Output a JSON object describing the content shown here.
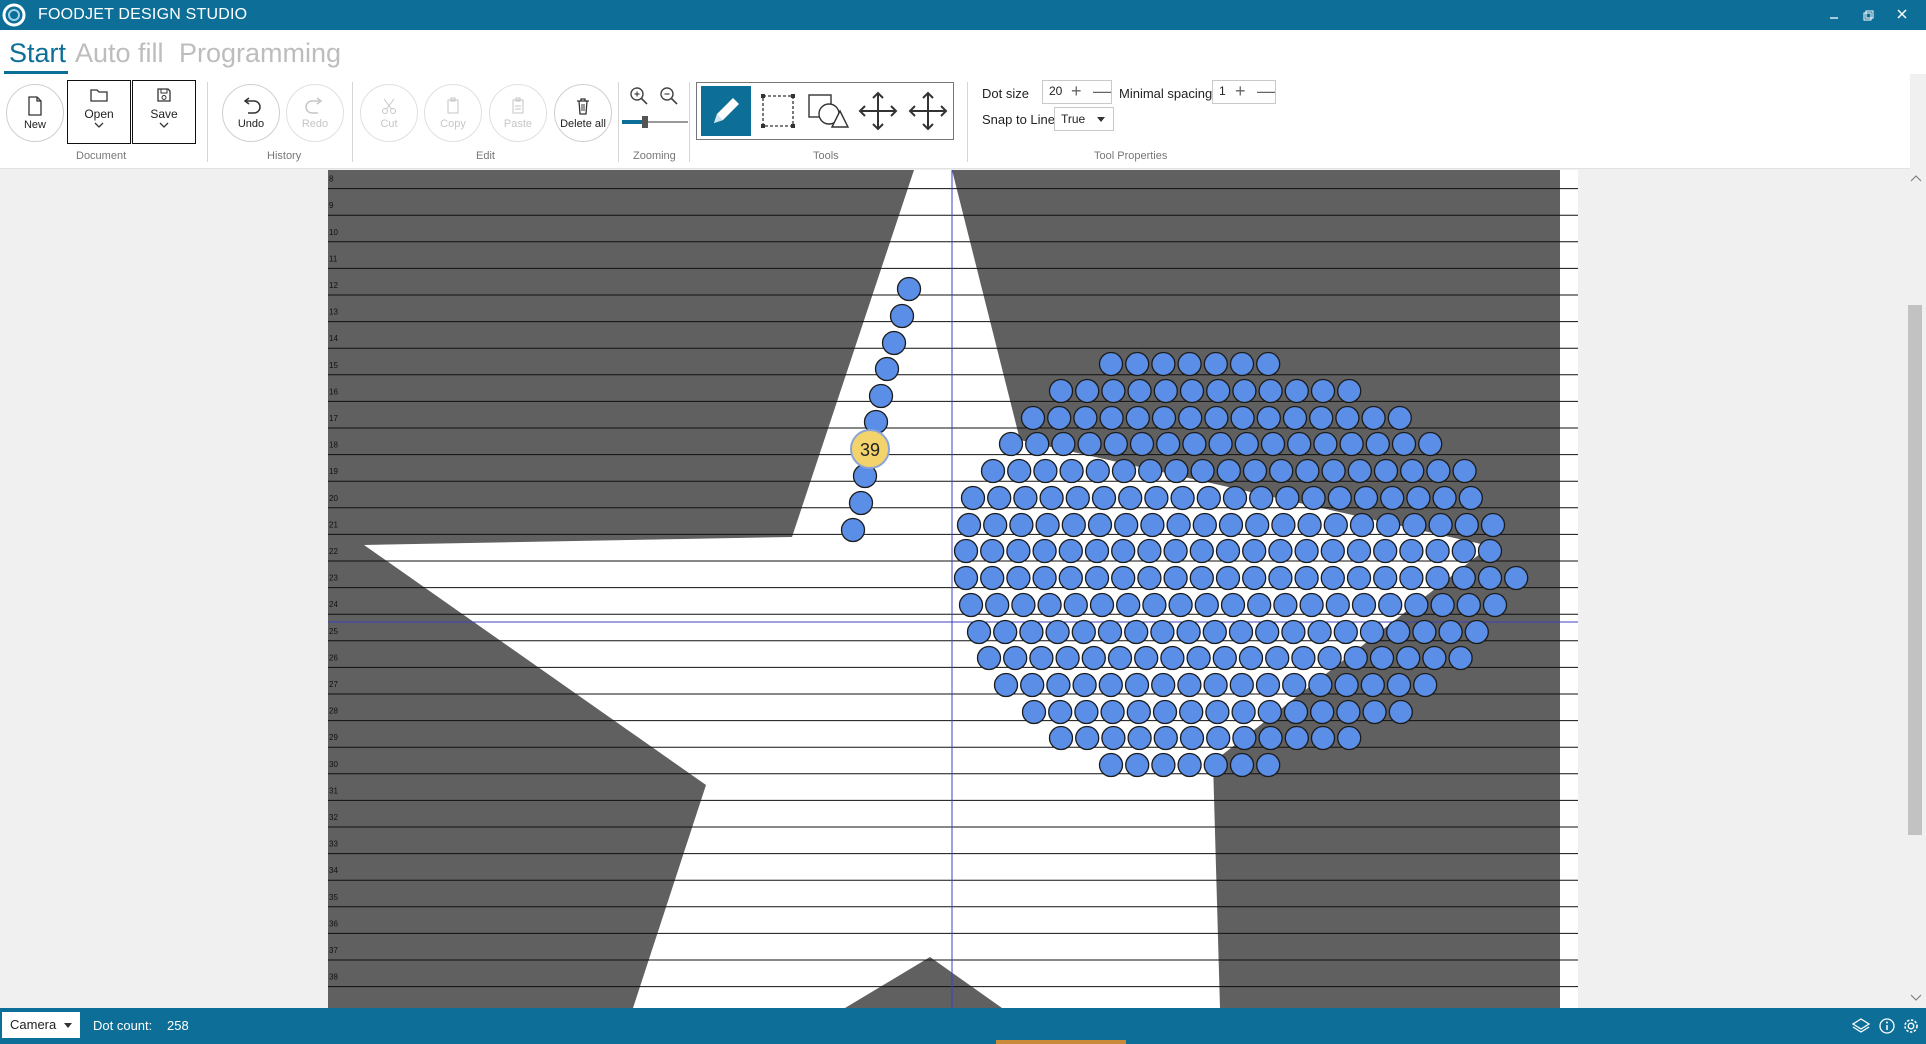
{
  "window": {
    "title": "FOODJET DESIGN STUDIO"
  },
  "tabs": [
    {
      "label": "Start",
      "active": true
    },
    {
      "label": "Auto fill",
      "active": false
    },
    {
      "label": "Programming",
      "active": false
    }
  ],
  "ribbon": {
    "document": {
      "group": "Document",
      "new": "New",
      "open": "Open",
      "save": "Save"
    },
    "history": {
      "group": "History",
      "undo": "Undo",
      "redo": "Redo"
    },
    "edit": {
      "group": "Edit",
      "cut": "Cut",
      "copy": "Copy",
      "paste": "Paste",
      "delete_all": "Delete all"
    },
    "zooming": {
      "group": "Zooming",
      "zoom_level": 0.35
    },
    "tools": {
      "group": "Tools",
      "active_tool": "pencil"
    },
    "tool_properties": {
      "group": "Tool Properties",
      "dot_size_label": "Dot size",
      "dot_size_value": "20",
      "min_spacing_label": "Minimal spacing",
      "min_spacing_value": "1",
      "snap_label": "Snap to Line",
      "snap_value": "True"
    }
  },
  "canvas": {
    "row_numbers": [
      "8",
      "9",
      "10",
      "11",
      "12",
      "13",
      "14",
      "15",
      "16",
      "17",
      "18",
      "19",
      "20",
      "21",
      "22",
      "23",
      "24",
      "25",
      "26",
      "27",
      "28",
      "29",
      "30",
      "31",
      "32",
      "33",
      "34",
      "35",
      "36",
      "37",
      "38"
    ],
    "highlight_label": "39",
    "colors": {
      "background": "#606060",
      "shape": "#ffffff",
      "dot": "#5b8ee6",
      "highlight": "#f3d36b"
    }
  },
  "status": {
    "camera": "Camera",
    "dot_count_label": "Dot count:",
    "dot_count_value": "258"
  },
  "colors": {
    "accent": "#0d6f98"
  }
}
